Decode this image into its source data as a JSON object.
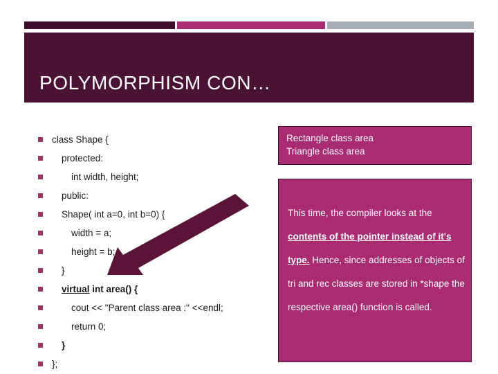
{
  "slide": {
    "title": "POLYMORPHISM CON…",
    "background": "#ffffff"
  },
  "decor": {
    "bars": [
      {
        "name": "bar-dark",
        "color": "#3E0F2B"
      },
      {
        "name": "bar-pink",
        "color": "#A92B72"
      },
      {
        "name": "bar-gray",
        "color": "#A6AEB4"
      }
    ],
    "title_band_color": "#4A1235",
    "bullet_color": "#A03260",
    "arrow_color": "#5B1437"
  },
  "code_list": [
    {
      "indent": 0,
      "text": "class Shape {"
    },
    {
      "indent": 1,
      "text": "protected:"
    },
    {
      "indent": 2,
      "text": "int width, height;"
    },
    {
      "indent": 1,
      "text": "public:"
    },
    {
      "indent": 1,
      "text": "Shape( int a=0, int b=0)  {"
    },
    {
      "indent": 2,
      "text": "width = a;"
    },
    {
      "indent": 2,
      "text": "height = b;"
    },
    {
      "indent": 1,
      "text": "}"
    },
    {
      "indent": 1,
      "text": "virtual int area() {",
      "keyword": "virtual",
      "rest": " int area() {"
    },
    {
      "indent": 2,
      "text": "cout << \"Parent class area :\" <<endl;"
    },
    {
      "indent": 2,
      "text": "return 0;"
    },
    {
      "indent": 1,
      "text": "}",
      "bold": true
    },
    {
      "indent": 0,
      "text": "};"
    }
  ],
  "output_box": {
    "line1": "Rectangle class area",
    "line2": "Triangle class area",
    "text": "Rectangle class area\nTriangle class area"
  },
  "explain_box": {
    "part1": "This time, the compiler looks at the ",
    "emphasis": "contents of the pointer instead of it's type.",
    "part2": " Hence, since addresses of objects of tri and rec classes are stored in *shape the respective area() function is called.",
    "full": "This time, the compiler looks at the contents of the pointer instead of it's type. Hence, since addresses of objects of tri and rec classes are stored in *shape the respective area() function is called."
  }
}
